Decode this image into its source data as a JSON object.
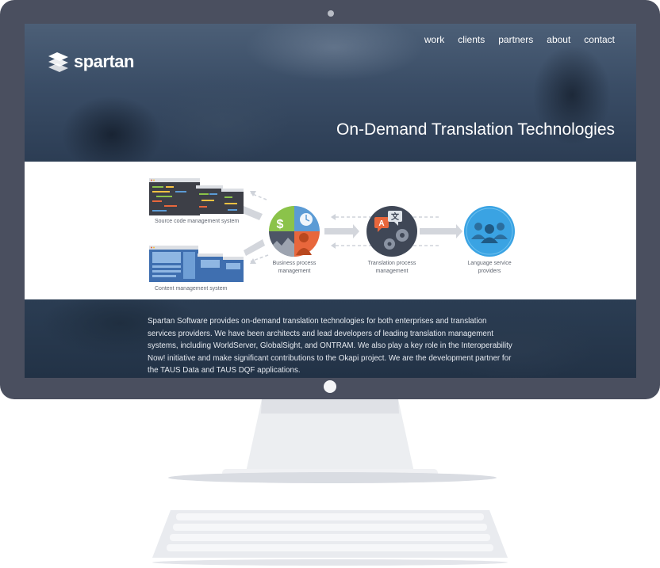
{
  "site": {
    "logo_text": "spartan",
    "nav": [
      "work",
      "clients",
      "partners",
      "about",
      "contact"
    ],
    "tagline": "On-Demand Translation Technologies"
  },
  "diagram": {
    "labels": {
      "source_code": "Source code management system",
      "content_mgmt": "Content management system",
      "business_line1": "Business process",
      "business_line2": "management",
      "translation_line1": "Translation process",
      "translation_line2": "management",
      "lsp_line1": "Language service",
      "lsp_line2": "providers"
    },
    "colors": {
      "green": "#8bc34a",
      "blue": "#5b9bd5",
      "orange": "#e8673c",
      "dark": "#3f4756",
      "accent_blue": "#3aa3e3"
    }
  },
  "about": {
    "text": "Spartan Software provides on-demand translation technologies for both enterprises and translation services providers. We have been architects and lead developers of leading translation management systems, including WorldServer, GlobalSight, and ONTRAM. We also play a key role in the Interoperability Now! initiative and make significant contributions to the Okapi project. We are the development partner for the TAUS Data and TAUS DQF applications."
  }
}
